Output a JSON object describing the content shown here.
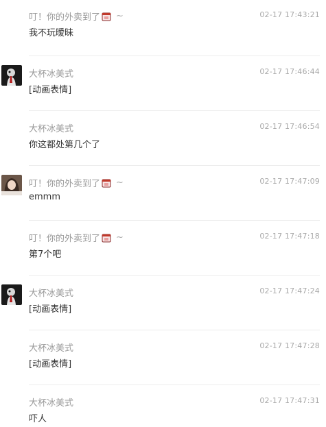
{
  "messages": [
    {
      "nickname": "叮！你的外卖到了",
      "suffix": "~",
      "time": "02-17 17:43:21",
      "text": "我不玩暧昧",
      "avatar": "none",
      "emoji": "takeout-box-icon"
    },
    {
      "nickname": "大杯冰美式",
      "suffix": "",
      "time": "02-17 17:46:44",
      "text": "[动画表情]",
      "avatar": "dark-figure-avatar",
      "emoji": ""
    },
    {
      "nickname": "大杯冰美式",
      "suffix": "",
      "time": "02-17 17:46:54",
      "text": "你这都处第几个了",
      "avatar": "none",
      "emoji": ""
    },
    {
      "nickname": "叮！你的外卖到了",
      "suffix": "~",
      "time": "02-17 17:47:09",
      "text": "emmm",
      "avatar": "girl-photo-avatar",
      "emoji": "takeout-box-icon"
    },
    {
      "nickname": "叮！你的外卖到了",
      "suffix": "~",
      "time": "02-17 17:47:18",
      "text": "第7个吧",
      "avatar": "none",
      "emoji": "takeout-box-icon"
    },
    {
      "nickname": "大杯冰美式",
      "suffix": "",
      "time": "02-17 17:47:24",
      "text": "[动画表情]",
      "avatar": "dark-figure-avatar",
      "emoji": ""
    },
    {
      "nickname": "大杯冰美式",
      "suffix": "",
      "time": "02-17 17:47:28",
      "text": "[动画表情]",
      "avatar": "none",
      "emoji": ""
    },
    {
      "nickname": "大杯冰美式",
      "suffix": "",
      "time": "02-17 17:47:31",
      "text": "吓人",
      "avatar": "none",
      "emoji": ""
    }
  ],
  "colors": {
    "nickname": "#9a9a9a",
    "time": "#a8a8a8",
    "text": "#333333",
    "divider": "#ececec"
  }
}
